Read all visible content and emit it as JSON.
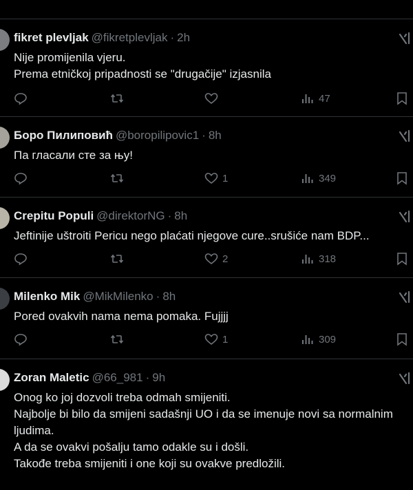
{
  "tweets": [
    {
      "display_name": "fikret plevljak",
      "handle": "@fikretplevljak",
      "time": "2h",
      "text": "Nije promijenila vjeru.\nPrema etničkoj pripadnosti se \"drugačije\" izjasnila",
      "likes": "",
      "views": "47"
    },
    {
      "display_name": "Боро Пилиповић",
      "handle": "@boropilipovic1",
      "time": "8h",
      "text": "Па гласали сте за њу!",
      "likes": "1",
      "views": "349"
    },
    {
      "display_name": "Crepitu Populi",
      "handle": "@direktorNG",
      "time": "8h",
      "text": "Jeftinije uštroiti Pericu nego plaćati njegove cure..srušiće nam BDP...",
      "likes": "2",
      "views": "318"
    },
    {
      "display_name": "Milenko Mik",
      "handle": "@MikMilenko",
      "time": "8h",
      "text": "Pored ovakvih nama nema pomaka. Fujjjj",
      "likes": "1",
      "views": "309"
    },
    {
      "display_name": "Zoran Maletic",
      "handle": "@66_981",
      "time": "9h",
      "text": "Onog ko joj dozvoli treba odmah smijeniti.\nNajbolje bi bilo da smijeni sadašnji UO i da se imenuje novi sa normalnim ljudima.\nA da se ovakvi pošalju tamo odakle su i došli.\nTakođe treba smijeniti i one koji su ovakve predložili.",
      "likes": "",
      "views": ""
    }
  ],
  "icons": {
    "reply": "reply-icon",
    "retweet": "retweet-icon",
    "like": "heart-icon",
    "views": "views-icon",
    "bookmark": "bookmark-icon",
    "grok": "grok-icon"
  },
  "colors": {
    "background": "#000000",
    "text": "#e7e9ea",
    "secondary": "#71767b",
    "divider": "#2f3336"
  }
}
